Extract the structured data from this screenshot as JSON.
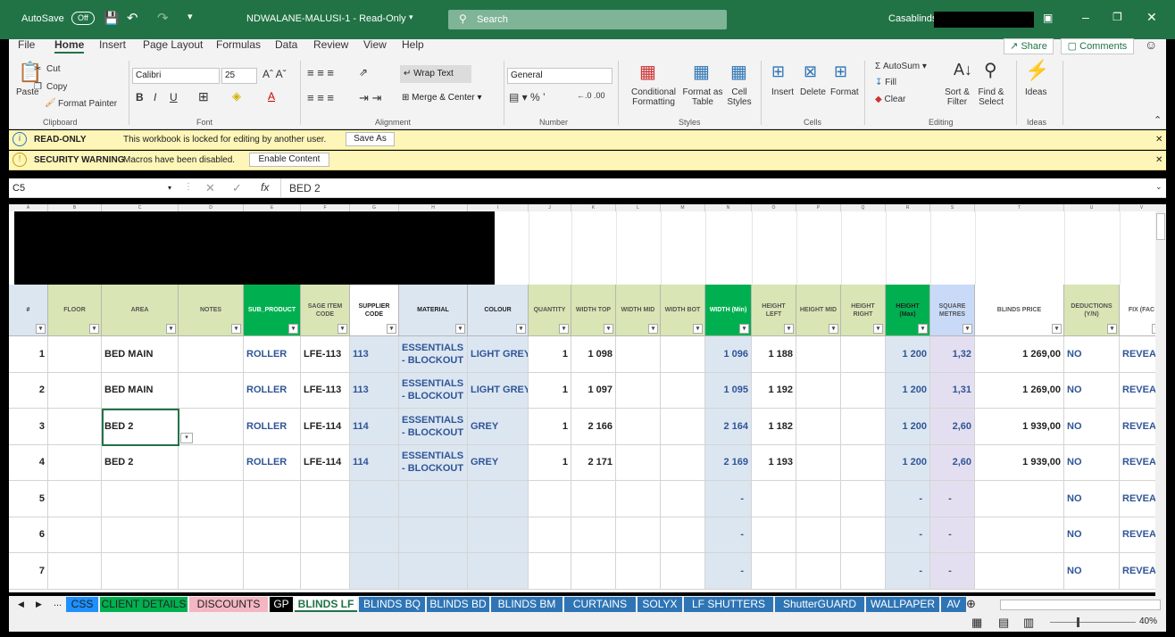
{
  "title_bar": {
    "autosave": "AutoSave",
    "toggle": "Off",
    "filename": "NDWALANE-MALUSI-1 - Read-Only",
    "search": "Search",
    "account": "Casablinds \\"
  },
  "menu": [
    "File",
    "Home",
    "Insert",
    "Page Layout",
    "Formulas",
    "Data",
    "Review",
    "View",
    "Help"
  ],
  "menu_right": {
    "share": "Share",
    "comments": "Comments"
  },
  "ribbon": {
    "clipboard": {
      "paste": "Paste",
      "cut": "Cut",
      "copy": "Copy",
      "format_painter": "Format Painter",
      "label": "Clipboard"
    },
    "font": {
      "name": "Calibri",
      "size": "25",
      "label": "Font"
    },
    "alignment": {
      "wrap": "Wrap Text",
      "merge": "Merge & Center",
      "label": "Alignment"
    },
    "number": {
      "format": "General",
      "label": "Number"
    },
    "styles": {
      "conditional": "Conditional Formatting",
      "table": "Format as Table",
      "cell": "Cell Styles",
      "label": "Styles"
    },
    "cells": {
      "insert": "Insert",
      "delete": "Delete",
      "format": "Format",
      "label": "Cells"
    },
    "editing": {
      "autosum": "AutoSum",
      "fill": "Fill",
      "clear": "Clear",
      "sort": "Sort & Filter",
      "find": "Find & Select",
      "label": "Editing"
    },
    "ideas": {
      "ideas": "Ideas",
      "label": "Ideas"
    }
  },
  "banners": {
    "readonly_title": "READ-ONLY",
    "readonly_msg": "This workbook is locked for editing by another user.",
    "save_as": "Save As",
    "security_title": "SECURITY WARNING",
    "security_msg": "Macros have been disabled.",
    "enable": "Enable Content"
  },
  "formula_bar": {
    "name_box": "C5",
    "fx": "fx",
    "value": "BED 2"
  },
  "columns": [
    "A",
    "B",
    "C",
    "D",
    "E",
    "F",
    "G",
    "H",
    "I",
    "J",
    "K",
    "L",
    "M",
    "N",
    "O",
    "P",
    "Q",
    "R",
    "S",
    "T",
    "U",
    "V"
  ],
  "headers": [
    "#",
    "FLOOR",
    "AREA",
    "NOTES",
    "SUB_PRODUCT",
    "SAGE ITEM CODE",
    "SUPPLIER CODE",
    "MATERIAL",
    "COLOUR",
    "QUANTITY",
    "WIDTH TOP",
    "WIDTH MID",
    "WIDTH BOT",
    "WIDTH (Min)",
    "HEIGHT LEFT",
    "HEIGHT MID",
    "HEIGHT RIGHT",
    "HEIGHT (Max)",
    "SQUARE METRES",
    "BLINDS PRICE",
    "DEDUCTIONS (Y/N)",
    "FIX (FAC"
  ],
  "rows": [
    [
      "1",
      "",
      "BED MAIN",
      "",
      "ROLLER",
      "LFE-113",
      "113",
      "ESSENTIALS - BLOCKOUT",
      "LIGHT GREY",
      "1",
      "1 098",
      "",
      "",
      "1 096",
      "1 188",
      "",
      "",
      "1 200",
      "1,32",
      "1 269,00",
      "NO",
      "REVEAL"
    ],
    [
      "2",
      "",
      "BED MAIN",
      "",
      "ROLLER",
      "LFE-113",
      "113",
      "ESSENTIALS - BLOCKOUT",
      "LIGHT GREY",
      "1",
      "1 097",
      "",
      "",
      "1 095",
      "1 192",
      "",
      "",
      "1 200",
      "1,31",
      "1 269,00",
      "NO",
      "REVEAL"
    ],
    [
      "3",
      "",
      "BED 2",
      "",
      "ROLLER",
      "LFE-114",
      "114",
      "ESSENTIALS - BLOCKOUT",
      "GREY",
      "1",
      "2 166",
      "",
      "",
      "2 164",
      "1 182",
      "",
      "",
      "1 200",
      "2,60",
      "1 939,00",
      "NO",
      "REVEAL"
    ],
    [
      "4",
      "",
      "BED 2",
      "",
      "ROLLER",
      "LFE-114",
      "114",
      "ESSENTIALS - BLOCKOUT",
      "GREY",
      "1",
      "2 171",
      "",
      "",
      "2 169",
      "1 193",
      "",
      "",
      "1 200",
      "2,60",
      "1 939,00",
      "NO",
      "REVEAL"
    ],
    [
      "5",
      "",
      "",
      "",
      "",
      "",
      "",
      "",
      "",
      "",
      "",
      "",
      "",
      "-",
      "",
      "",
      "",
      "-",
      "-",
      "",
      "NO",
      "REVEAL"
    ],
    [
      "6",
      "",
      "",
      "",
      "",
      "",
      "",
      "",
      "",
      "",
      "",
      "",
      "",
      "-",
      "",
      "",
      "",
      "-",
      "-",
      "",
      "NO",
      "REVEAL"
    ],
    [
      "7",
      "",
      "",
      "",
      "",
      "",
      "",
      "",
      "",
      "",
      "",
      "",
      "",
      "-",
      "",
      "",
      "",
      "-",
      "-",
      "",
      "NO",
      "REVEAL"
    ]
  ],
  "tabs": [
    "CSS",
    "CLIENT DETAILS",
    "DISCOUNTS",
    "GP",
    "BLINDS LF",
    "BLINDS BQ",
    "BLINDS BD",
    "BLINDS BM",
    "CURTAINS",
    "SOLYX",
    "LF SHUTTERS",
    "ShutterGUARD",
    "WALLPAPER",
    "AV"
  ],
  "tab_colors": [
    "#1e90ff",
    "#00b050",
    "#f4b6c2",
    "#000000",
    "#ffffff",
    "#2e75b6",
    "#2e75b6",
    "#2e75b6",
    "#2e75b6",
    "#2e75b6",
    "#2e75b6",
    "#2e75b6",
    "#2e75b6",
    "#2e75b6"
  ],
  "tab_more": "...",
  "status": {
    "zoom": "40%"
  }
}
